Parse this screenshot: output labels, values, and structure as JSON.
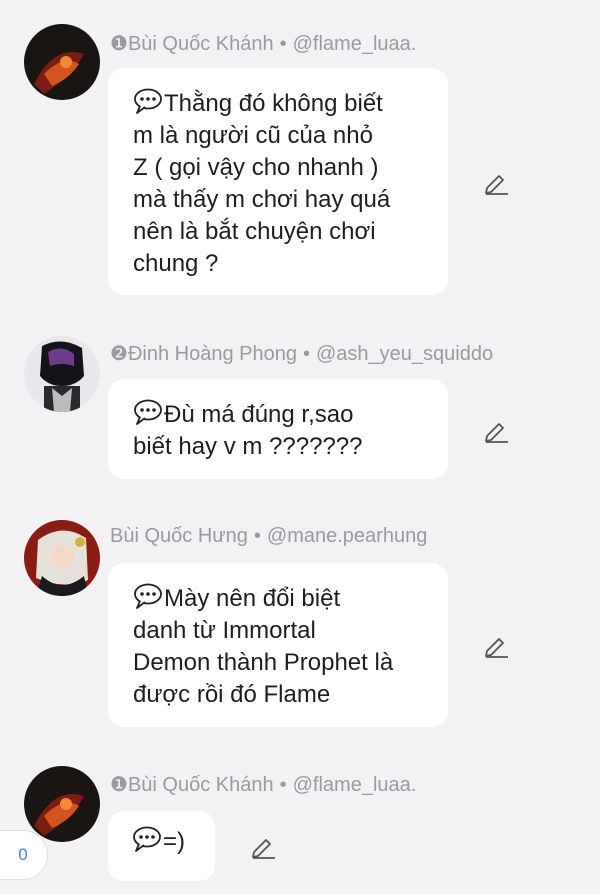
{
  "messages": [
    {
      "rank": "❶",
      "name": "Bùi Quốc Khánh",
      "handle": "@flame_luaa.",
      "lines": [
        "Thằng đó không biết",
        "m là người cũ của nhỏ",
        "Z ( gọi vậy cho nhanh )",
        "mà thấy m chơi hay quá",
        "nên là bắt chuyện chơi",
        "chung ?"
      ]
    },
    {
      "rank": "❷",
      "name": "Đinh Hoàng Phong",
      "handle": "@ash_yeu_squiddo",
      "lines": [
        "Đù má đúng r,sao",
        "biết hay v m ???????"
      ]
    },
    {
      "rank": "",
      "name": "Bùi Quốc Hưng",
      "handle": "@mane.pearhung",
      "lines": [
        "Mày nên đổi biệt",
        "danh từ Immortal",
        "Demon thành Prophet là",
        "được rồi đó Flame"
      ]
    },
    {
      "rank": "❶",
      "name": "Bùi Quốc Khánh",
      "handle": "@flame_luaa.",
      "lines": [
        "=)"
      ]
    }
  ],
  "separator": "•",
  "counter": "0",
  "icons": {
    "speech": "speech-balloon-icon",
    "edit": "pencil-edit-icon"
  },
  "colors": {
    "background": "#f2f2f4",
    "bubble": "#ffffff",
    "meta": "#9a9aa0",
    "counter": "#4a7fd0"
  }
}
